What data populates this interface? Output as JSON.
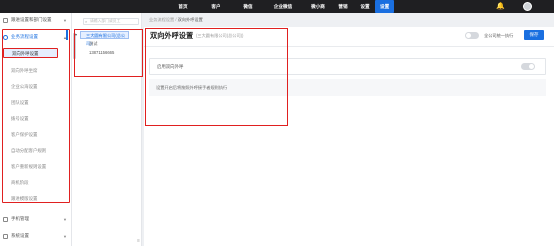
{
  "topbar": {
    "nav": [
      "首页",
      "客户",
      "微信",
      "企业微信",
      "微小商",
      "营销",
      "设置",
      "设置"
    ],
    "active_index": 7
  },
  "sidebar": {
    "groups": [
      {
        "label": "跟进设置和部门设置",
        "open": false
      },
      {
        "label": "业务流程设置",
        "open": true
      },
      {
        "label": "手机管理",
        "open": false
      },
      {
        "label": "系统设置",
        "open": false
      }
    ],
    "items": [
      "双向外呼设置",
      "双向外呼坐席",
      "企业公海设置",
      "团队设置",
      "拨号设置",
      "客户保护设置",
      "自动分配客户规则",
      "客户重新规则设置",
      "商机阶段",
      "跟进模版设置"
    ],
    "selected_index": 0
  },
  "orgpanel": {
    "search_placeholder": "请输入部门或员工",
    "company": "三大圆有限公司(总公司)",
    "user_name": "测试",
    "user_phone": "13871156665"
  },
  "breadcrumb": {
    "parent": "业务流程设置",
    "separator": "/",
    "current": "双向外呼设置"
  },
  "main": {
    "title": "双向外呼设置",
    "title_sub": "(三大圆有限公司(总公司))",
    "batch_label": "全公司统一执行",
    "save_label": "保存",
    "setting_label": "启用双向外呼",
    "description": "设置开启后将按照外呼接手者规则执行"
  },
  "colors": {
    "accent": "#1a6fe0",
    "highlight_border": "#e02020",
    "topbar": "#1f1f22"
  }
}
